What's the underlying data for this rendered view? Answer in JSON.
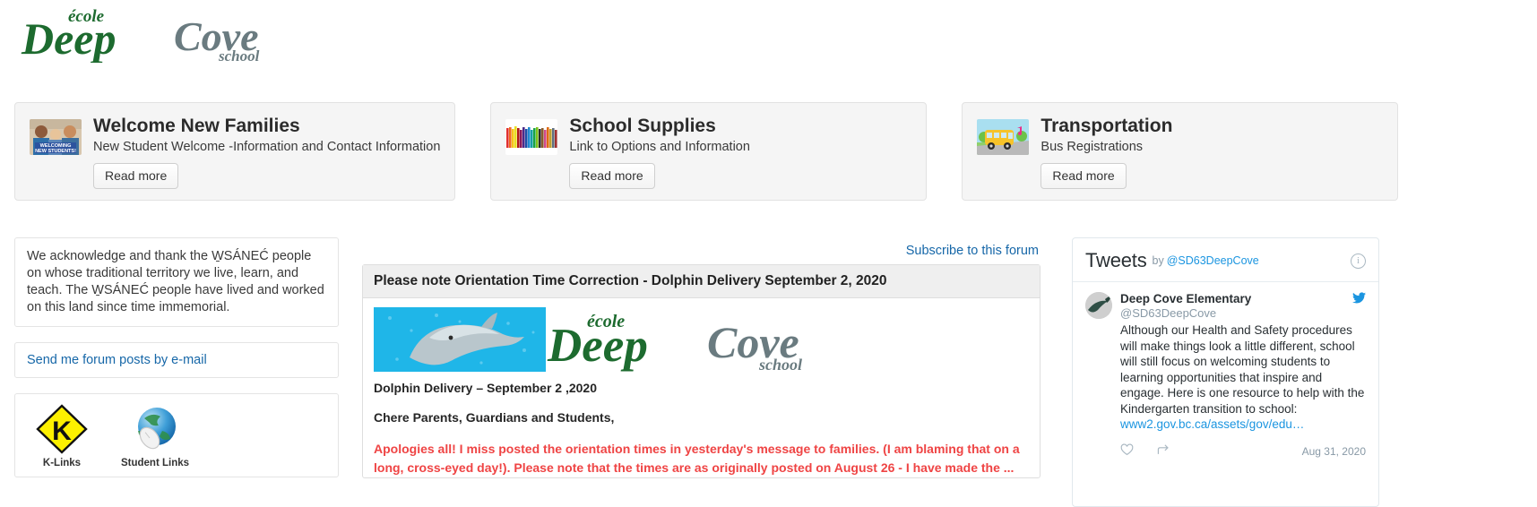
{
  "logo": {
    "accent_word": "école",
    "word1": "Deep",
    "word2": "Cove",
    "subword": "school",
    "green": "#1d6b2f",
    "gray": "#6a7b80",
    "alt": "école Deep Cove school"
  },
  "cards": [
    {
      "title": "Welcome New Families",
      "subtitle": "New Student Welcome -Information and Contact Information",
      "button": "Read more",
      "thumb_icon": "students-photo-thumbnail"
    },
    {
      "title": "School Supplies",
      "subtitle": "Link to Options and Information",
      "button": "Read more",
      "thumb_icon": "colored-pencils-thumbnail"
    },
    {
      "title": "Transportation",
      "subtitle": "Bus Registrations",
      "button": "Read more",
      "thumb_icon": "school-bus-thumbnail"
    }
  ],
  "left": {
    "acknowledgement": "We acknowledge and thank the W̱SÁNEĆ people on whose traditional territory we live, learn, and teach. The W̱SÁNEĆ people have lived and worked on this land since time immemorial.",
    "email_link": "Send me forum posts by e-mail",
    "link_tiles": [
      {
        "caption": "K-Links",
        "icon": "k-links-diamond-icon"
      },
      {
        "caption": "Student Links",
        "icon": "globe-mouse-icon"
      }
    ]
  },
  "forum": {
    "subscribe_link": "Subscribe to this forum",
    "post": {
      "title": "Please note Orientation Time Correction - Dolphin Delivery September 2, 2020",
      "banner_alt": "Dolphin photo beside école Deep Cove school logo",
      "line1": "Dolphin Delivery – September 2 ,2020",
      "line2": "Chere Parents, Guardians and Students,",
      "excerpt": "Apologies all!  I miss posted the orientation times in yesterday's message to families.  (I am blaming that on a long, cross-eyed day!). Please note that the times are as originally posted on August 26 - I have made the ...",
      "excerpt_color": "#ef4444"
    }
  },
  "twitter": {
    "header_title": "Tweets",
    "header_by": "by",
    "header_handle": "@SD63DeepCove",
    "info_icon": "info-icon",
    "tweets": [
      {
        "name": "Deep Cove Elementary",
        "handle": "@SD63DeepCove",
        "text": "Although our Health and Safety procedures will make things look a little different, school will still focus on welcoming students to learning opportunities that inspire and engage.  Here is one resource to help with the Kindergarten transition to school: ",
        "link": "www2.gov.bc.ca/assets/gov/edu…",
        "date": "Aug 31, 2020",
        "actions": [
          "like-icon",
          "share-icon"
        ]
      }
    ],
    "accent": "#1b95e0"
  }
}
